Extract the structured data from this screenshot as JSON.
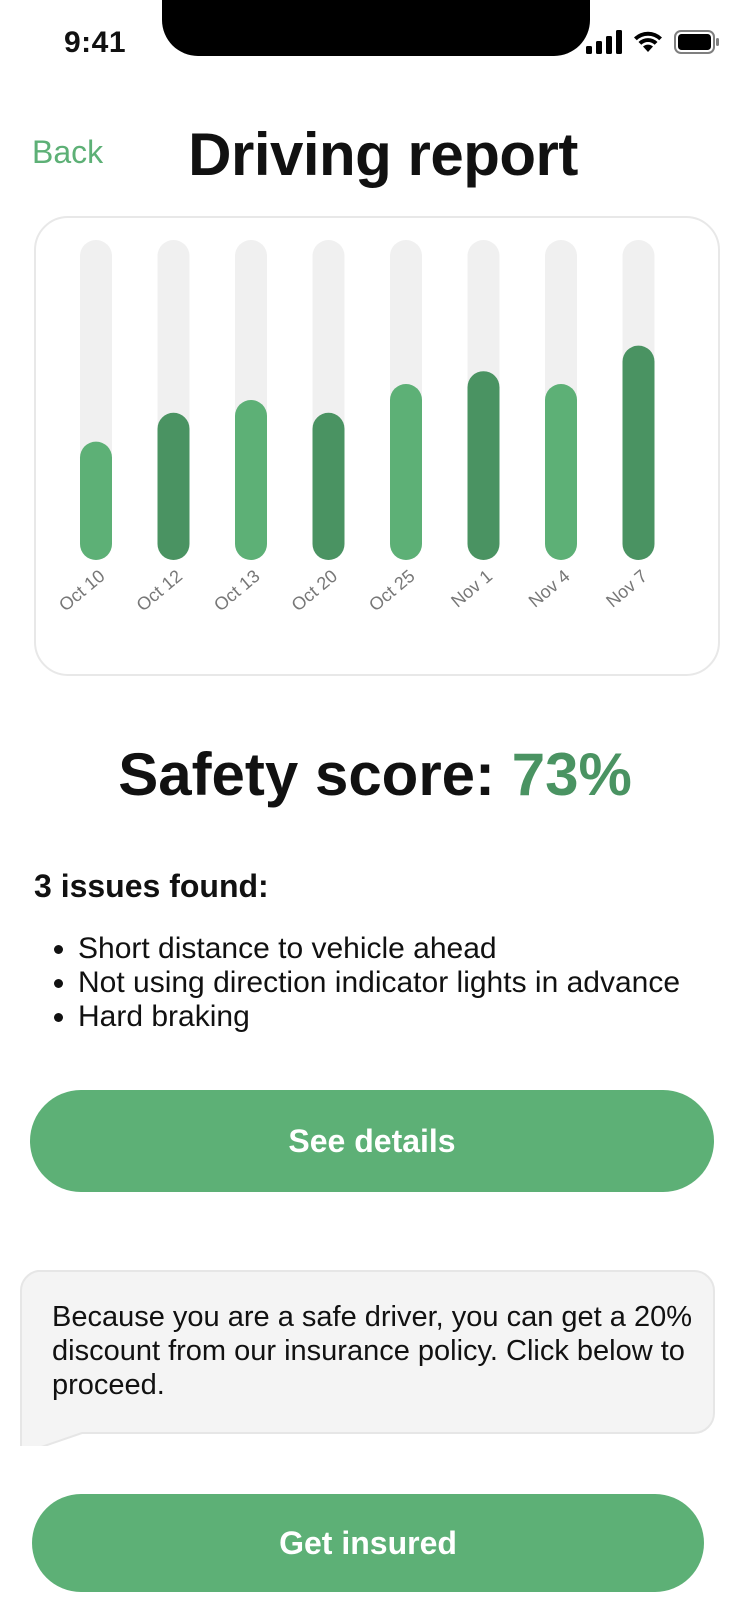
{
  "status_bar": {
    "time": "9:41"
  },
  "header": {
    "back_label": "Back",
    "title": "Driving report"
  },
  "chart_data": {
    "type": "bar",
    "categories": [
      "Oct 10",
      "Oct 12",
      "Oct 13",
      "Oct 20",
      "Oct 25",
      "Nov 1",
      "Nov 4",
      "Nov 7"
    ],
    "values": [
      37,
      46,
      50,
      46,
      55,
      59,
      55,
      67
    ],
    "ylim": [
      0,
      100
    ],
    "colors": [
      "#5db076",
      "#4a9362",
      "#5db076",
      "#4a9362",
      "#5db076",
      "#4a9362",
      "#5db076",
      "#4a9362"
    ],
    "track_color": "#f0f0f0",
    "title": "",
    "xlabel": "",
    "ylabel": ""
  },
  "score": {
    "label": "Safety score:",
    "value": "73%",
    "accent": "#4a9362"
  },
  "issues": {
    "title": "3 issues found:",
    "items": [
      "Short distance to vehicle ahead",
      "Not using direction indicator lights in advance",
      "Hard braking"
    ]
  },
  "details_button": {
    "label": "See details"
  },
  "offer": {
    "text": "Because you are a safe driver, you can get a 20% discount from our insurance policy. Click below to proceed."
  },
  "insure_button": {
    "label": "Get insured"
  },
  "brand_color": "#5db076"
}
